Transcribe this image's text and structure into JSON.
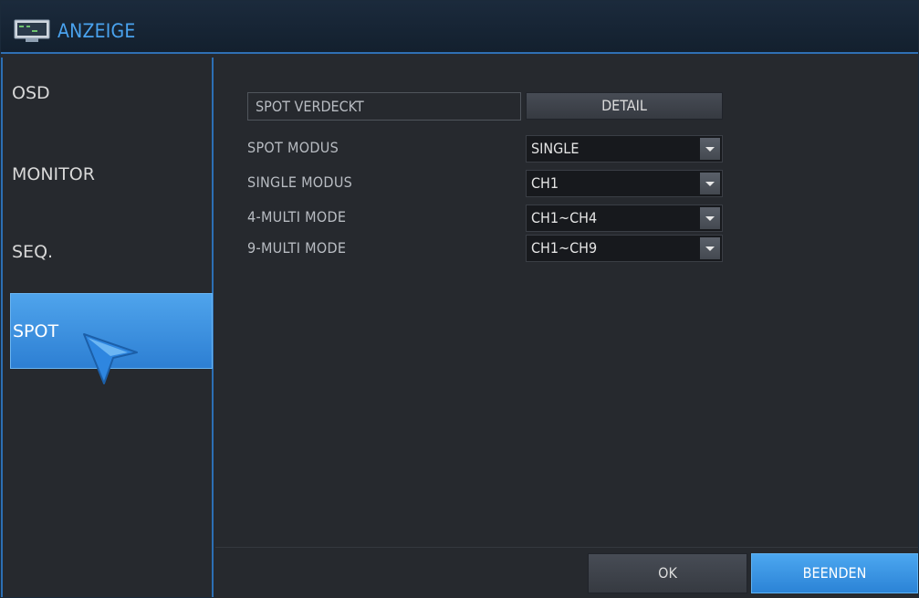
{
  "window": {
    "title": "ANZEIGE",
    "icon": "monitor-icon"
  },
  "sidebar": {
    "items": [
      {
        "label": "OSD",
        "active": false
      },
      {
        "label": "MONITOR",
        "active": false
      },
      {
        "label": "SEQ.",
        "active": false
      },
      {
        "label": "SPOT",
        "active": true
      }
    ]
  },
  "spot": {
    "hidden_label": "SPOT VERDECKT",
    "detail_button": "DETAIL",
    "settings": [
      {
        "label": "SPOT MODUS",
        "value": "SINGLE"
      },
      {
        "label": "SINGLE MODUS",
        "value": "CH1"
      },
      {
        "label": "4-MULTI MODE",
        "value": "CH1~CH4"
      },
      {
        "label": "9-MULTI MODE",
        "value": "CH1~CH9"
      }
    ]
  },
  "footer": {
    "ok_label": "OK",
    "exit_label": "BEENDEN"
  },
  "colors": {
    "accent": "#3b92e3",
    "title_text": "#4aa3ef",
    "background": "#26292e"
  }
}
